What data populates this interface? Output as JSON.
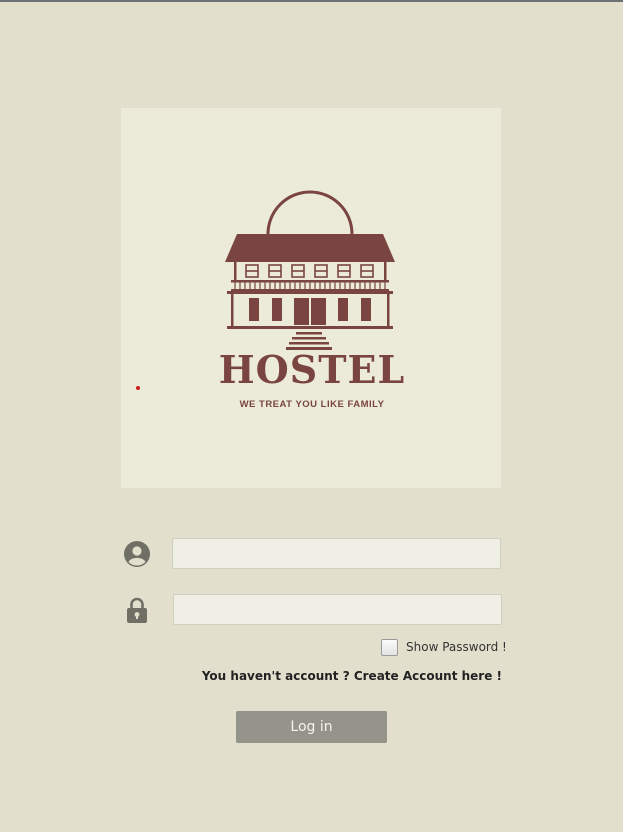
{
  "logo": {
    "title": "HOSTEL",
    "tagline": "WE TREAT YOU LIKE FAMILY",
    "icon": "hostel-building-logo",
    "color": "#7a4540",
    "panel_color": "#ecead9"
  },
  "form": {
    "username": {
      "icon": "user-icon",
      "value": "",
      "placeholder": ""
    },
    "password": {
      "icon": "lock-icon",
      "value": "",
      "placeholder": ""
    },
    "show_password_label": "Show Password !",
    "show_password_checked": false,
    "create_account_text": "You haven't account ? Create Account here !",
    "login_label": "Log in"
  },
  "colors": {
    "background": "#e2e0cd",
    "button": "#94948a",
    "icon": "#6f6f65"
  }
}
